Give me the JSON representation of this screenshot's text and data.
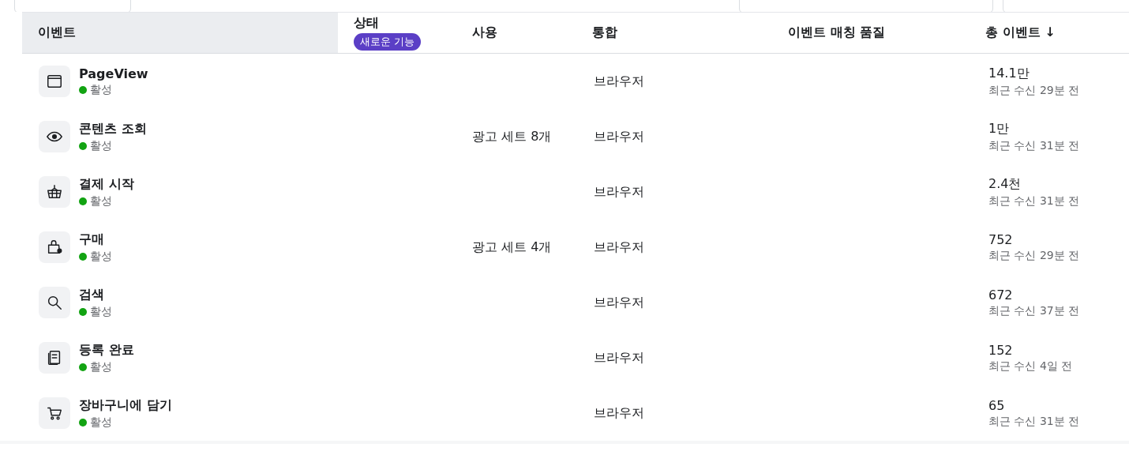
{
  "top_fields": [
    {
      "kind": "field"
    },
    {
      "kind": "field"
    },
    {
      "kind": "field"
    }
  ],
  "table": {
    "columns": [
      {
        "label": "이벤트",
        "highlighted": true
      },
      {
        "label": "상태",
        "highlighted": false,
        "badge": "새로운 기능"
      },
      {
        "label": "사용",
        "highlighted": false
      },
      {
        "label": "통합",
        "highlighted": false
      },
      {
        "label": "이벤트 매칭 품질",
        "highlighted": false
      },
      {
        "label": "총 이벤트",
        "highlighted": false,
        "sort_arrow": "↓"
      }
    ],
    "rows": [
      {
        "name": "PageView",
        "status": "활성",
        "color": "#12a312",
        "usage": "",
        "integration": "브라우저",
        "total": "14.1만",
        "last_received": "최근 수신 29분 전"
      },
      {
        "name": "콘텐츠 조회",
        "status": "활성",
        "color": "#12a312",
        "usage": "광고 세트 8개",
        "integration": "브라우저",
        "total": "1만",
        "last_received": "최근 수신 31분 전"
      },
      {
        "name": "결제 시작",
        "status": "활성",
        "color": "#12a312",
        "usage": "",
        "integration": "브라우저",
        "total": "2.4천",
        "last_received": "최근 수신 31분 전"
      },
      {
        "name": "구매",
        "status": "활성",
        "color": "#12a312",
        "usage": "광고 세트 4개",
        "integration": "브라우저",
        "total": "752",
        "last_received": "최근 수신 29분 전"
      },
      {
        "name": "검색",
        "status": "활성",
        "color": "#12a312",
        "usage": "",
        "integration": "브라우저",
        "total": "672",
        "last_received": "최근 수신 37분 전"
      },
      {
        "name": "등록 완료",
        "status": "활성",
        "color": "#12a312",
        "usage": "",
        "integration": "브라우저",
        "total": "152",
        "last_received": "최근 수신 4일 전"
      },
      {
        "name": "장바구니에 담기",
        "status": "활성",
        "color": "#12a312",
        "usage": "",
        "integration": "브라우저",
        "total": "65",
        "last_received": "최근 수신 31분 전"
      }
    ]
  }
}
